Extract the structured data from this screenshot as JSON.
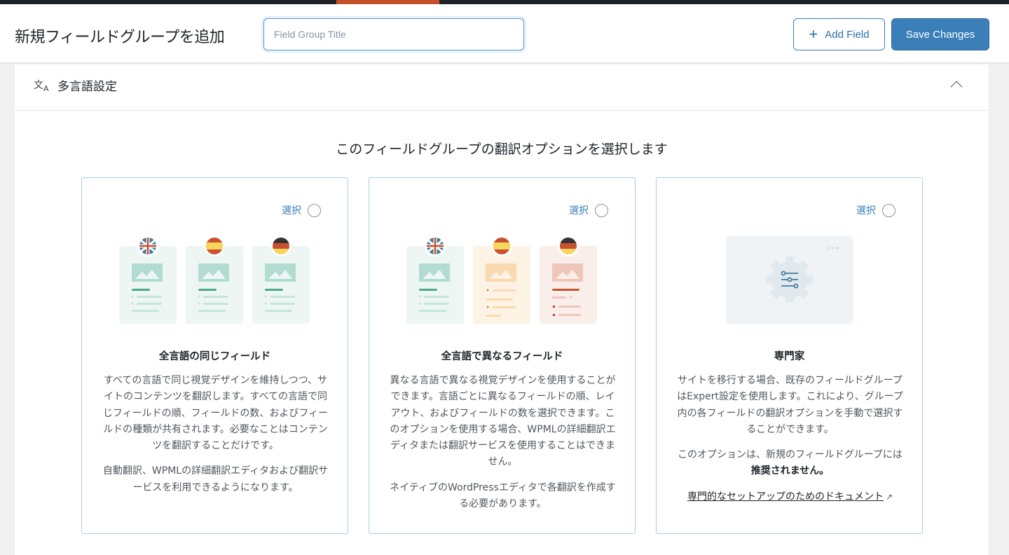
{
  "header": {
    "title": "新規フィールドグループを追加",
    "title_placeholder": "Field Group Title",
    "add_field_label": "Add Field",
    "save_label": "Save Changes"
  },
  "panel": {
    "title": "多言語設定",
    "icon": "translate-icon",
    "heading": "このフィールドグループの翻訳オプションを選択します"
  },
  "cards": [
    {
      "select_label": "選択",
      "title": "全言語の同じフィールド",
      "paragraphs": [
        "すべての言語で同じ視覚デザインを維持しつつ、サイトのコンテンツを翻訳します。すべての言語で同じフィールドの順、フィールドの数、およびフィールドの種類が共有されます。必要なことはコンテンツを翻訳することだけです。",
        "自動翻訳、WPMLの詳細翻訳エディタおよび翻訳サービスを利用できるようになります。"
      ]
    },
    {
      "select_label": "選択",
      "title": "全言語で異なるフィールド",
      "paragraphs": [
        "異なる言語で異なる視覚デザインを使用することができます。言語ごとに異なるフィールドの順、レイアウト、およびフィールドの数を選択できます。このオプションを使用する場合、WPMLの詳細翻訳エディタまたは翻訳サービスを使用することはできません。",
        "ネイティブのWordPressエディタで各翻訳を作成する必要があります。"
      ]
    },
    {
      "select_label": "選択",
      "title": "専門家",
      "paragraphs": [
        "サイトを移行する場合、既存のフィールドグループはExpert設定を使用します。これにより、グループ内の各フィールドの翻訳オプションを手動で選択することができます。"
      ],
      "note_prefix": "このオプションは、新規のフィールドグループには",
      "note_bold": "推奨されません。",
      "link": "専門的なセットアップのためのドキュメント"
    }
  ],
  "colors": {
    "accent": "#3a7fb8",
    "topbar": "#1d2327",
    "topbar_active": "#c4502b"
  }
}
